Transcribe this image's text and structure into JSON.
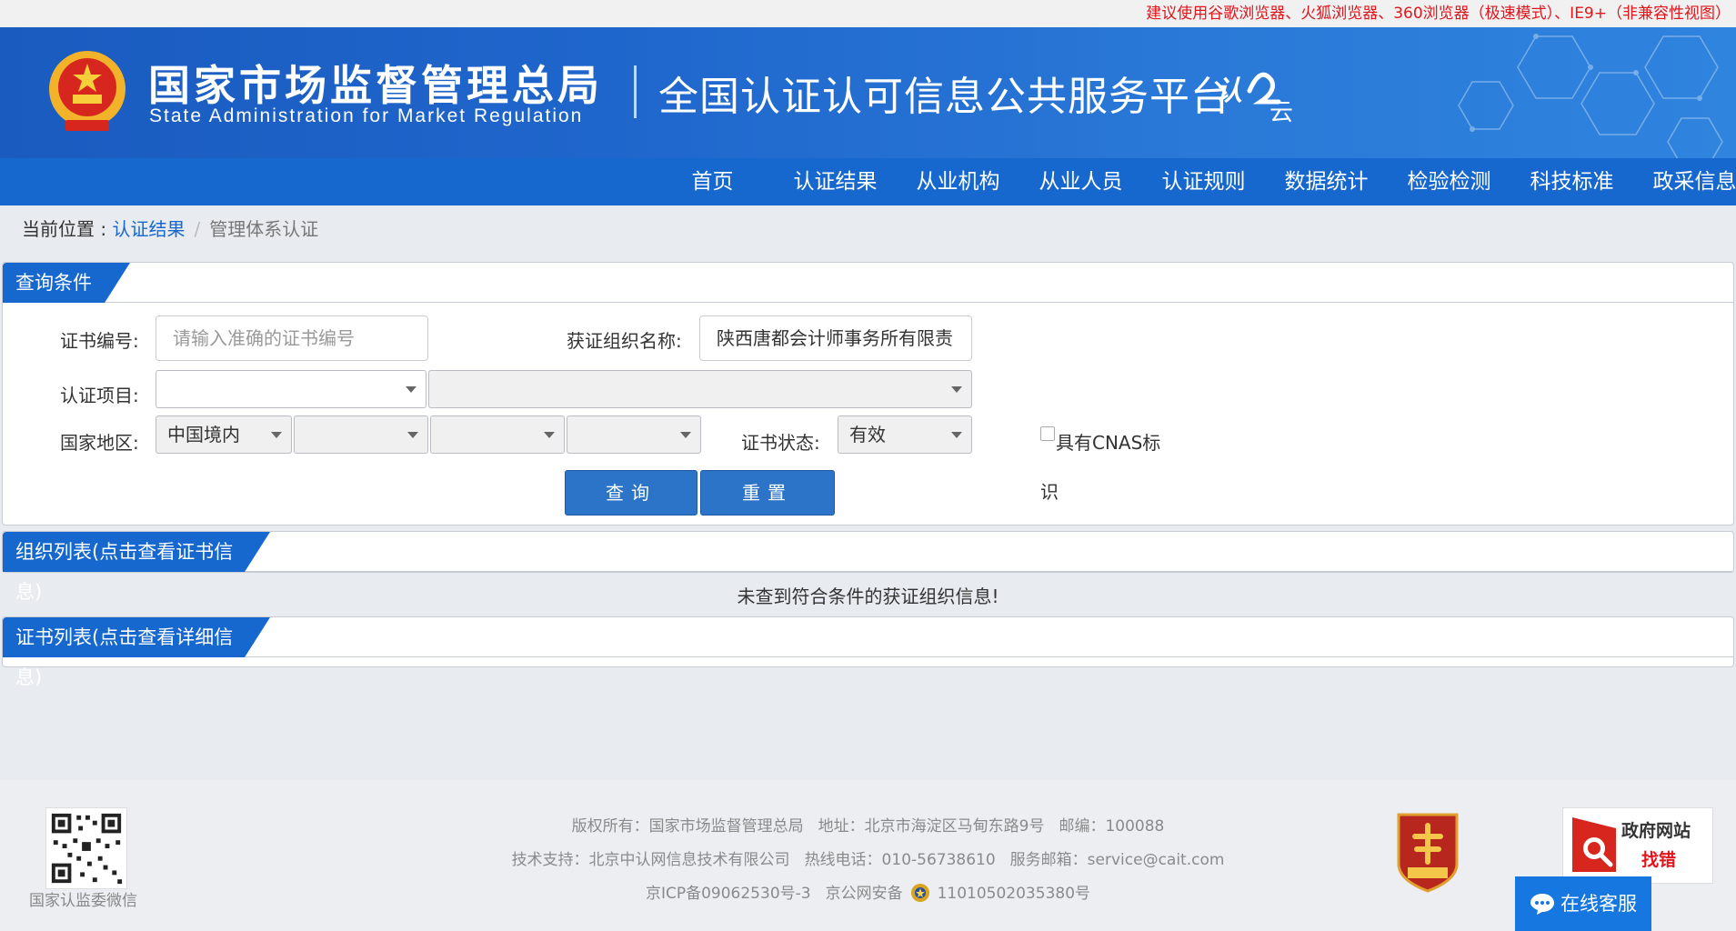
{
  "notice": "建议使用谷歌浏览器、火狐浏览器、360浏览器（极速模式）、IE9+（非兼容性视图）",
  "header": {
    "agency_cn": "国家市场监督管理总局",
    "agency_en": "State Administration  for  Market Regulation",
    "platform": "全国认证认可信息公共服务平台",
    "emblem_icon": "national-emblem-icon",
    "cloud_logo_icon": "renzheng-cloud-logo"
  },
  "nav": [
    "首页",
    "认证结果",
    "从业机构",
    "从业人员",
    "认证规则",
    "数据统计",
    "检验检测",
    "科技标准",
    "政采信息"
  ],
  "breadcrumb": {
    "prefix": "当前位置 : ",
    "link": "认证结果",
    "sep": "/",
    "current": "管理体系认证"
  },
  "query_panel": {
    "title": "查询条件",
    "cert_no_label": "证书编号:",
    "cert_no_placeholder": "请输入准确的证书编号",
    "org_name_label": "获证组织名称:",
    "org_name_value": "陕西唐都会计师事务所有限责",
    "project_label": "认证项目:",
    "project_value": "",
    "project_sub_value": "",
    "region_label": "国家地区:",
    "region_value": "中国境内",
    "status_label": "证书状态:",
    "status_value": "有效",
    "cnas_label_1": "具有CNAS标",
    "cnas_label_2": "识",
    "search_button": "查询",
    "reset_button": "重置"
  },
  "org_list": {
    "title": "组织列表(点击查看证书信息)",
    "empty_message": "未查到符合条件的获证组织信息!"
  },
  "cert_list": {
    "title": "证书列表(点击查看详细信息)"
  },
  "footer": {
    "qr_caption": "国家认监委微信",
    "copyright": "版权所有：国家市场监督管理总局",
    "address": "地址：北京市海淀区马甸东路9号",
    "postcode": "邮编：100088",
    "tech_support": "技术支持：北京中认网信息技术有限公司",
    "hotline": "热线电话：010-56738610",
    "email": "服务邮箱：service@cait.com",
    "icp": "京ICP备09062530号-3",
    "police_prefix": "京公网安备",
    "police_no": "11010502035380号",
    "find_error_1": "政府网站",
    "find_error_2": "找错",
    "online_service": "在线客服"
  },
  "colors": {
    "brand_blue": "#1668cf",
    "notice_red": "#e0161c",
    "button_blue": "#2c74c8"
  }
}
